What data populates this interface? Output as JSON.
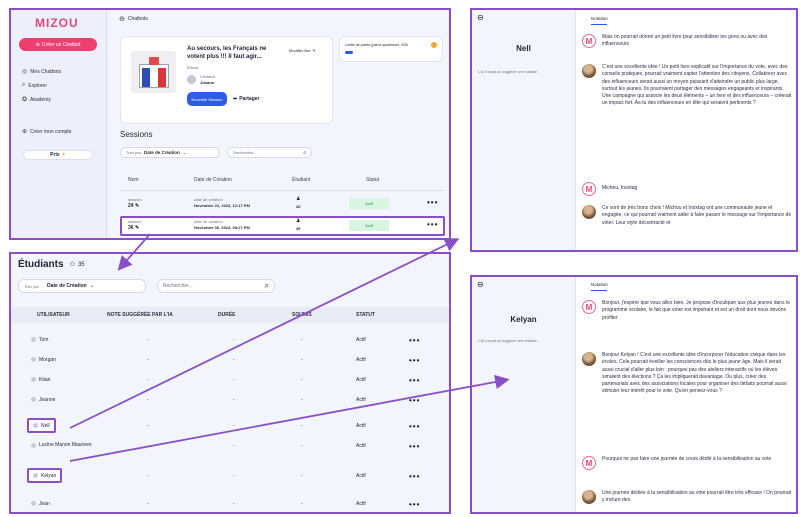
{
  "app": {
    "logo": "MIZOU"
  },
  "sidebar": {
    "create_label": "Créer un Chatbot",
    "items": [
      {
        "label": "Mes Chatbots",
        "icon": "chatbot-icon"
      },
      {
        "label": "Explorer",
        "icon": "search-icon"
      },
      {
        "label": "Akademy",
        "icon": "academy-icon"
      }
    ],
    "create_account": "Créer mon compte",
    "prices_label": "Prix"
  },
  "chatbot_page": {
    "back_label": "Chatbots",
    "bot_title": "Au secours, les Français ne votent plus !!! Il faut agir...",
    "bot_subtitle": "Éthnia",
    "creator_label": "Créateur",
    "creator_name": "Johann",
    "edit_label": "Modifier Bot",
    "new_session_label": "Nouvelle Session",
    "share_label": "Partager",
    "points_label": "Limite de points (parmi questions): 4/30",
    "sessions_title": "Sessions",
    "sort_label": "Trier par",
    "sort_value": "Date de Création",
    "search_placeholder": "Rechercher...",
    "columns": [
      "Nom",
      "Date de Création",
      "Étudiant",
      "Statut"
    ],
    "rows": [
      {
        "name_small": "session",
        "name": "24",
        "date_small": "date de création",
        "date": "Novembre 22, 2024, 12:17 PM",
        "students": "26",
        "status": "Actif"
      },
      {
        "name_small": "session",
        "name": "36",
        "date_small": "date de création",
        "date": "Novembre 06, 2024, 08:27 PM",
        "students": "35",
        "status": "Actif"
      }
    ]
  },
  "students_page": {
    "title": "Étudiants",
    "count": "35",
    "sort_label": "Trier par",
    "sort_value": "Date de Création",
    "search_placeholder": "Rechercher...",
    "columns": [
      "UTILISATEUR",
      "NOTE SUGGÉRÉE PAR L'IA",
      "DURÉE",
      "SOUMIS",
      "STATUT"
    ],
    "rows": [
      {
        "name": "Tom",
        "note": "-",
        "duree": "-",
        "soumis": "-",
        "status": "Actif"
      },
      {
        "name": "Morgan",
        "note": "-",
        "duree": "-",
        "soumis": "-",
        "status": "Actif"
      },
      {
        "name": "Kitan",
        "note": "-",
        "duree": "-",
        "soumis": "-",
        "status": "Actif"
      },
      {
        "name": "Jeanne",
        "note": "-",
        "duree": "-",
        "soumis": "-",
        "status": "Actif"
      },
      {
        "name": "Nell",
        "note": "-",
        "duree": "-",
        "soumis": "-",
        "status": "Actif"
      },
      {
        "name": "Lucine Manon Maureen",
        "note": "-",
        "duree": "-",
        "soumis": "-",
        "status": "Actif"
      },
      {
        "name": "Kelyan",
        "note": "-",
        "duree": "-",
        "soumis": "-",
        "status": "Actif"
      },
      {
        "name": "Jean",
        "note": "-",
        "duree": "-",
        "soumis": "-",
        "status": "Actif"
      }
    ]
  },
  "chat_nell": {
    "name": "Nell",
    "ia_note": "L'IA n'a pas pu suggérer une notation",
    "tab": "Notation",
    "messages": [
      {
        "role": "bot",
        "text": "Mais on pourrait donné un petit livre pour sensibiliser les gens ou avec des influenceurs"
      },
      {
        "role": "ai",
        "text": "C'est une excellente idée ! Un petit livre explicatif sur l'importance du vote, avec des conseils pratiques, pourrait vraiment capter l'attention des citoyens. Collaborer avec des influenceurs serait aussi un moyen puissant d'atteindre un public plus large, surtout les jeunes. Ils pourraient partager des messages engageants et inspirants. Une campagne qui associe les deux éléments – un livre et des influenceurs – créerait un impact fort. As-tu des influenceurs en tête qui seraient pertinents ?"
      },
      {
        "role": "bot",
        "text": "Micheu, Inoxtag"
      },
      {
        "role": "ai",
        "text": "Ce sont de très bons choix ! Michou et Inoxtag ont une communauté jeune et engagée, ce qui pourrait vraiment aider à faire passer le message sur l'importance de voter. Leur style décontracté et"
      }
    ]
  },
  "chat_kelyan": {
    "name": "Kelyan",
    "ia_note": "L'IA n'a pas pu suggérer une notation",
    "tab": "Notation",
    "messages": [
      {
        "role": "bot",
        "text": "Bonjour, j'espère que vous allez bien. Je propose d'inculquer aux plus jeunes dans le programme scolaire, le fait que voter est important et est un droit dont nous devons profiter"
      },
      {
        "role": "ai",
        "text": "Bonjour Kelyan ! C'est une excellente idée d'incorporer l'éducation civique dans les écoles. Cela pourrait éveiller les consciences dès le plus jeune âge. Mais il serait aussi crucial d'aller plus loin : pourquoi pas des ateliers interactifs où les élèves simulent des élections ? Ça les impliquerait davantage. Ou plus, créer des partenariats avec des associations locales pour organiser des débats pourrait aussi stimuler leur intérêt pour le vote. Qu'en pensez-vous ?"
      },
      {
        "role": "bot",
        "text": "Pourquoi ne pas faire une journée de cours dédié à la sensibilisation au vote"
      },
      {
        "role": "ai",
        "text": "Une journée dédiée à la sensibilisation au vote pourrait être très efficace ! On pourrait y inclure des"
      }
    ]
  },
  "colors": {
    "accent": "#8a4fc7",
    "brand": "#ee3f6f",
    "primary": "#2f5be4",
    "active": "#d8f5e1"
  }
}
